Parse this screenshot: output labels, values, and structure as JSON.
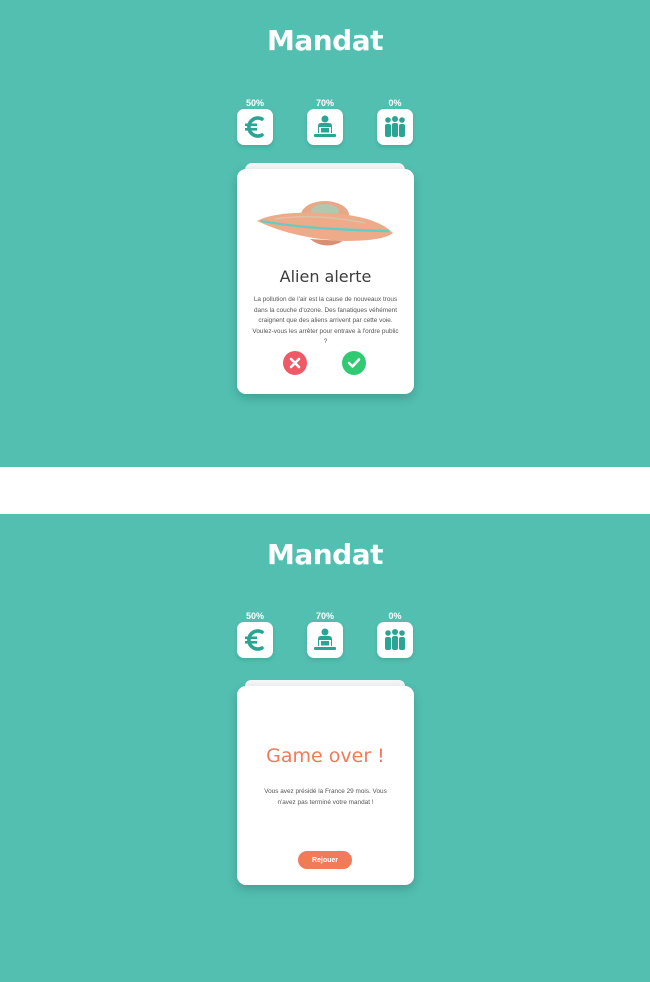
{
  "app": {
    "logo": "Mandat"
  },
  "colors": {
    "background": "#52bfb1",
    "icon": "#2aa594",
    "no": "#ef5a66",
    "yes": "#2fca72",
    "accent": "#f07a5a"
  },
  "stats": [
    {
      "label": "50%",
      "icon": "euro-icon",
      "value": 0.5
    },
    {
      "label": "70%",
      "icon": "podium-speaker-icon",
      "value": 0.7
    },
    {
      "label": "0%",
      "icon": "people-icon",
      "value": 0.0
    }
  ],
  "event_card": {
    "title": "Alien alerte",
    "image": "flying-saucer-image",
    "text": "La pollution de l'air est la cause de nouveaux trous dans la couche d'ozone. Des fanatiques véhément craignent que des aliens arrivent par cette voie. Voulez-vous les arrêter pour entrave à l'ordre public ?",
    "no_icon": "cross-icon",
    "yes_icon": "check-icon"
  },
  "game_over_card": {
    "title": "Game over !",
    "text": "Vous avez présidé la France 29 mois. Vous n'avez pas terminé votre mandat !",
    "button_label": "Rejouer"
  }
}
